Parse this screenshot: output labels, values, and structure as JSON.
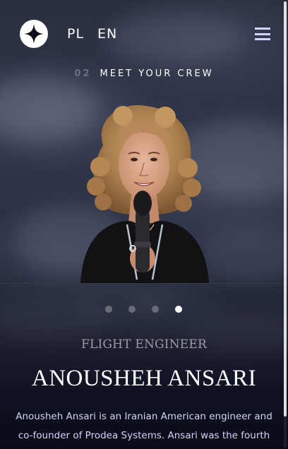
{
  "header": {
    "lang_options": [
      "PL",
      "EN"
    ]
  },
  "section": {
    "number": "02",
    "title": "MEET YOUR CREW"
  },
  "carousel": {
    "total": 4,
    "active_index": 3
  },
  "crew_member": {
    "role": "FLIGHT ENGINEER",
    "name": "ANOUSHEH ANSARI",
    "bio": "Anousheh Ansari is an Iranian American engineer and co-founder of Prodea Systems. Ansari was the fourth self-funded"
  },
  "colors": {
    "accent_light": "#d0d6f9",
    "background_dark": "#0b0d17",
    "dot_inactive": "#6a6c76",
    "dot_active": "#ffffff"
  },
  "icons": {
    "logo": "star-logo-icon",
    "menu": "hamburger-menu-icon"
  }
}
